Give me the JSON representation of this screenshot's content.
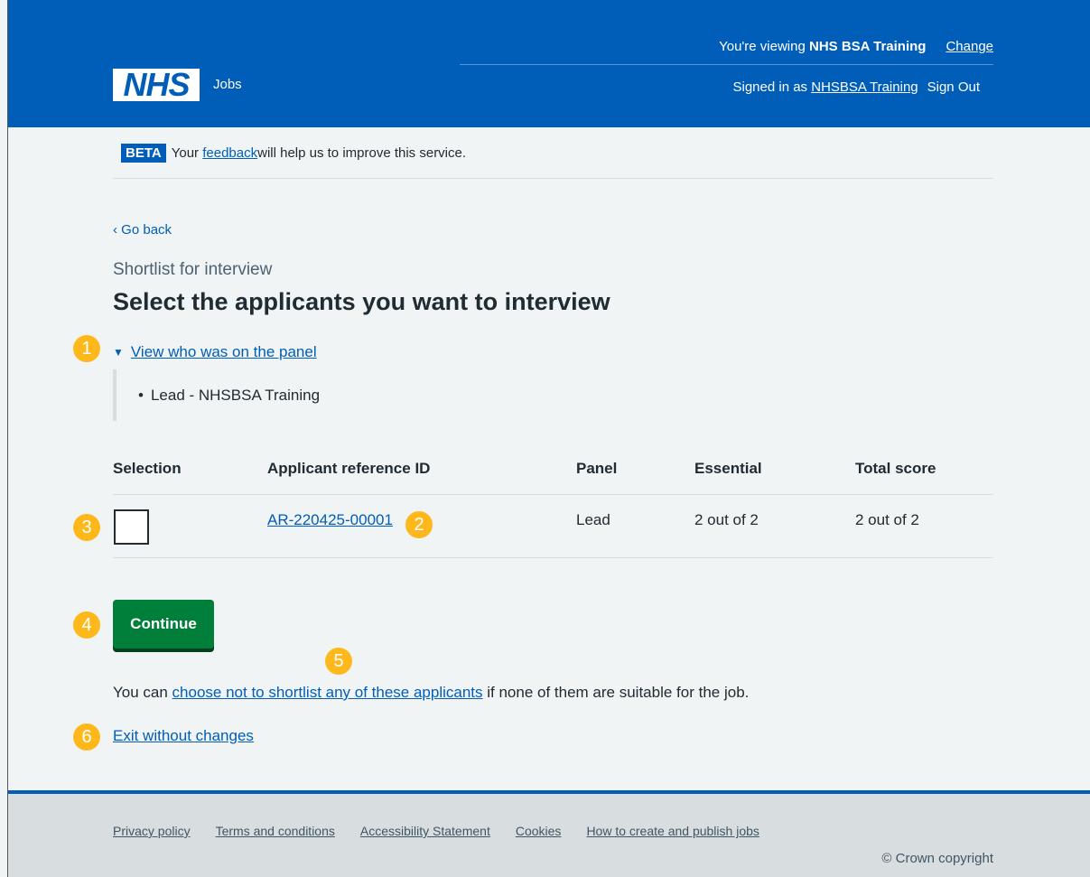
{
  "header": {
    "viewing_prefix": "You're viewing ",
    "viewing_org": "NHS BSA Training",
    "change_label": "Change",
    "logo_text": "NHS",
    "service_name": "Jobs",
    "signed_in_prefix": "Signed in as ",
    "signed_in_user": "NHSBSA Training",
    "sign_out_label": "Sign Out",
    "brand_color": "#005eb8"
  },
  "beta": {
    "tag": "BETA",
    "prefix": "Your ",
    "link": "feedback",
    "suffix": " will help us to improve this service."
  },
  "nav": {
    "back_label": "Go back",
    "back_icon": "chevron-left-icon"
  },
  "page": {
    "caption": "Shortlist for interview",
    "title": "Select the applicants you want to interview"
  },
  "panel_details": {
    "summary": "View who was on the panel",
    "items": [
      "Lead - NHSBSA Training"
    ]
  },
  "table": {
    "headers": [
      "Selection",
      "Applicant reference ID",
      "Panel",
      "Essential",
      "Total score"
    ],
    "rows": [
      {
        "selected": false,
        "ref_id": "AR-220425-00001",
        "panel": "Lead",
        "essential": "2 out of 2",
        "total": "2 out of 2"
      }
    ]
  },
  "actions": {
    "continue_label": "Continue",
    "continue_color": "#007f3b",
    "para_prefix": "You can ",
    "para_link": "choose not to shortlist any of these applicants",
    "para_suffix": " if none of them are suitable for the job.",
    "exit_label": "Exit without changes"
  },
  "markers": [
    "1",
    "2",
    "3",
    "4",
    "5",
    "6"
  ],
  "marker_color": "#ffb81c",
  "footer": {
    "links": [
      "Privacy policy",
      "Terms and conditions",
      "Accessibility Statement",
      "Cookies",
      "How to create and publish jobs"
    ],
    "copyright": "© Crown copyright"
  }
}
